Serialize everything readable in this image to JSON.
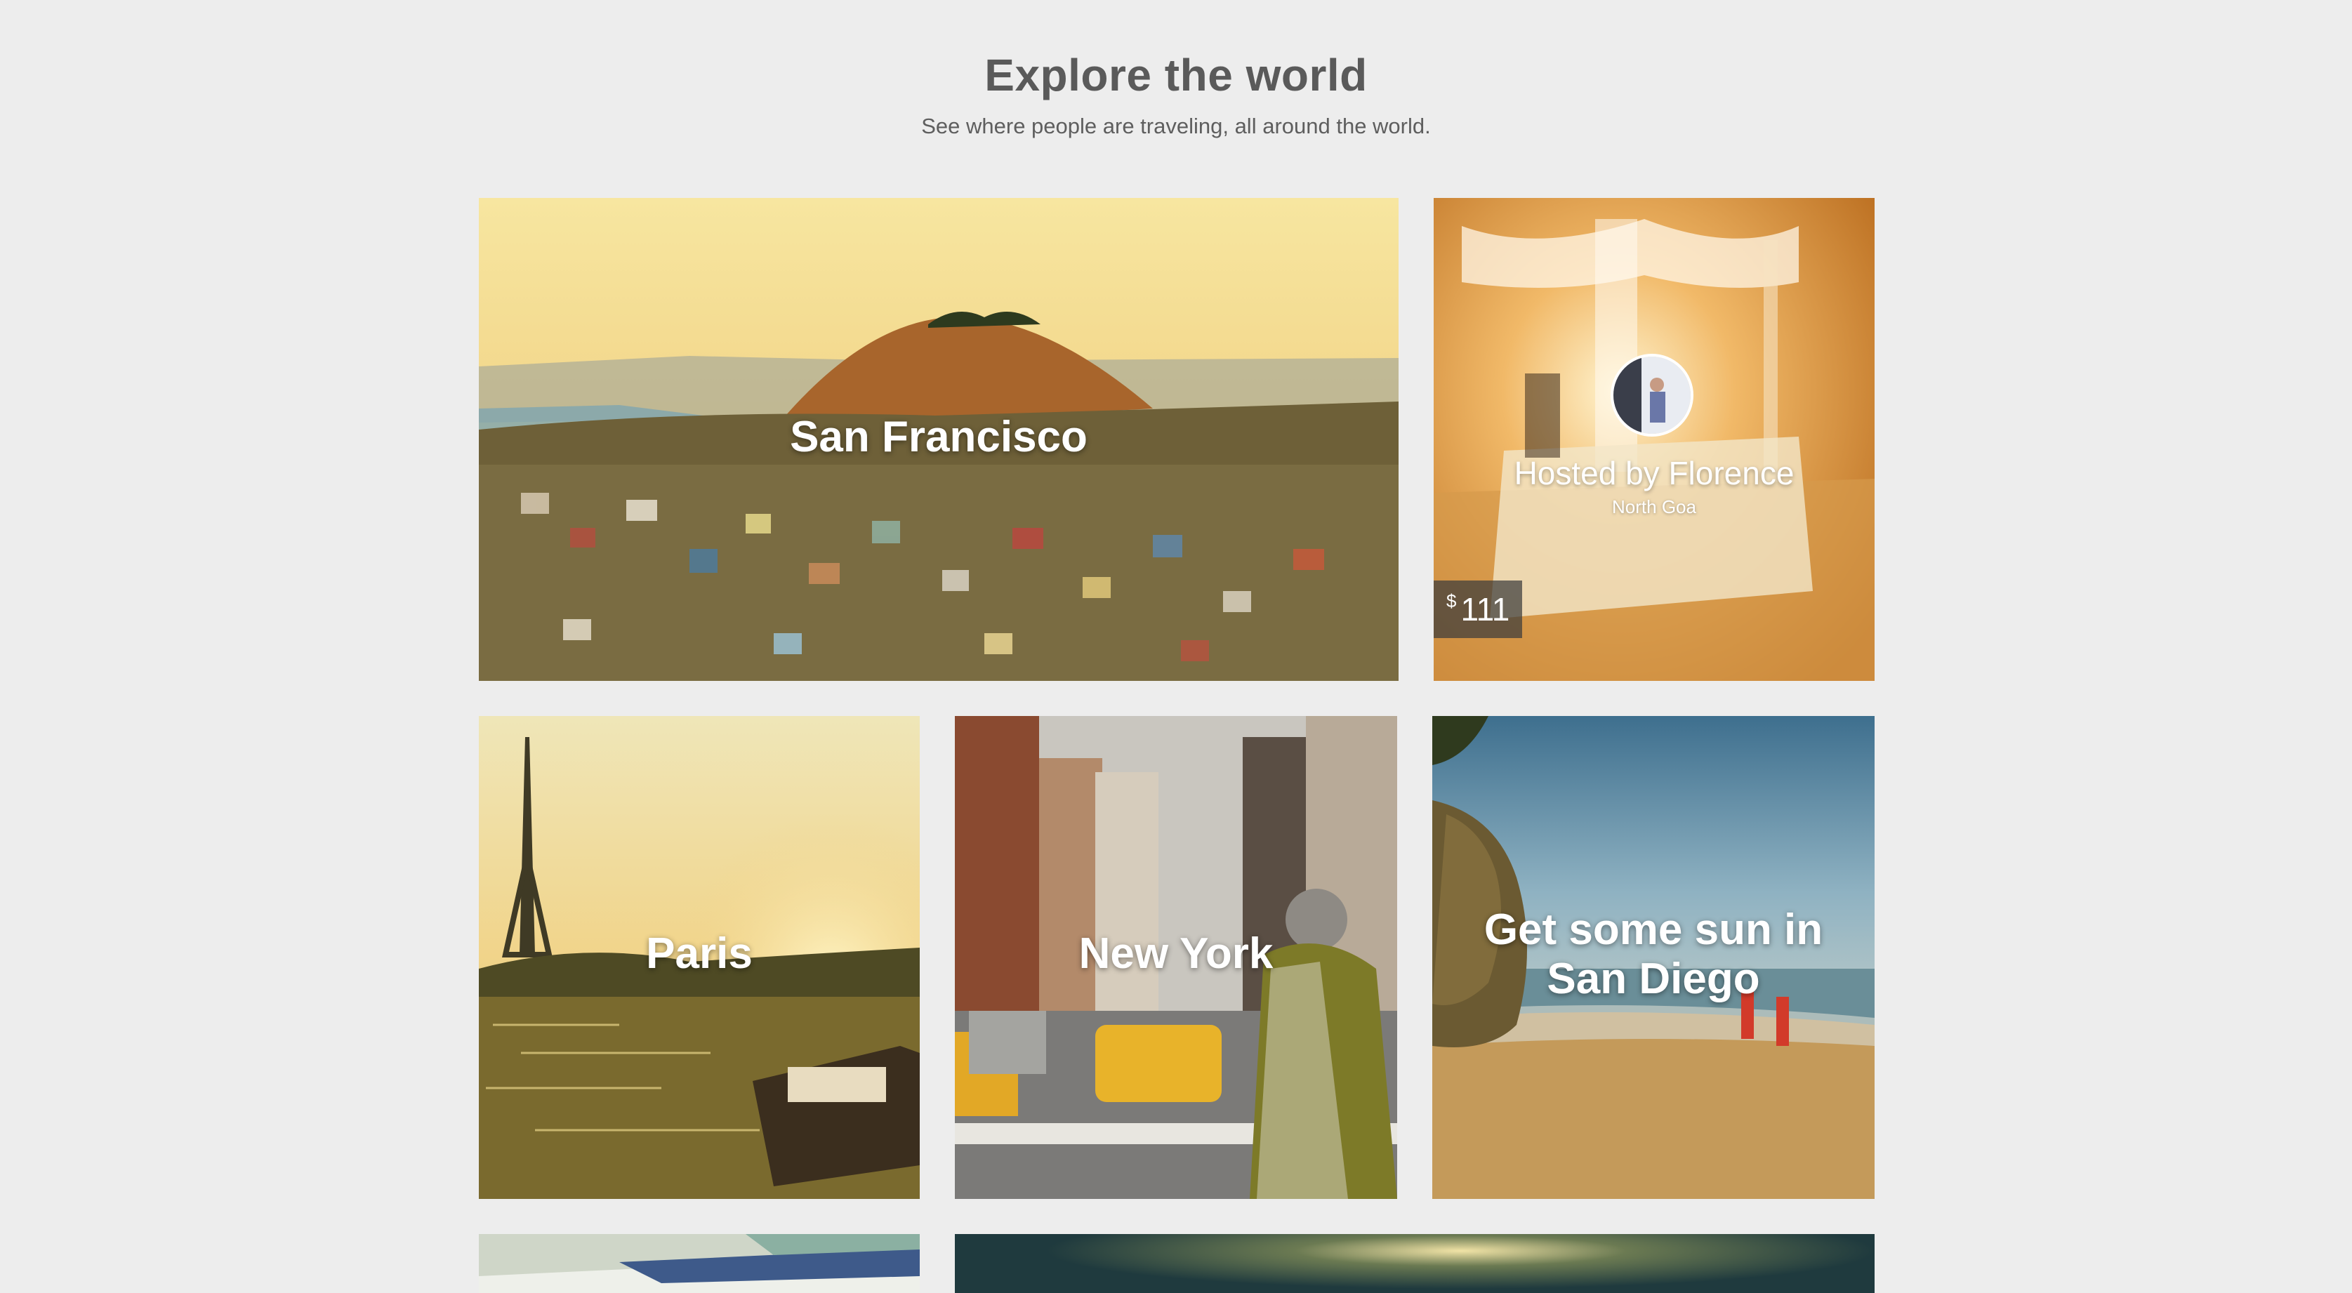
{
  "header": {
    "title": "Explore the world",
    "subtitle": "See where people are traveling, all around the world."
  },
  "tiles": {
    "san_francisco": {
      "label": "San Francisco"
    },
    "host": {
      "name": "Hosted by Florence",
      "location": "North Goa",
      "price_currency": "$",
      "price_value": "111"
    },
    "paris": {
      "label": "Paris"
    },
    "new_york": {
      "label": "New York"
    },
    "san_diego": {
      "label": "Get some sun in San Diego"
    }
  }
}
